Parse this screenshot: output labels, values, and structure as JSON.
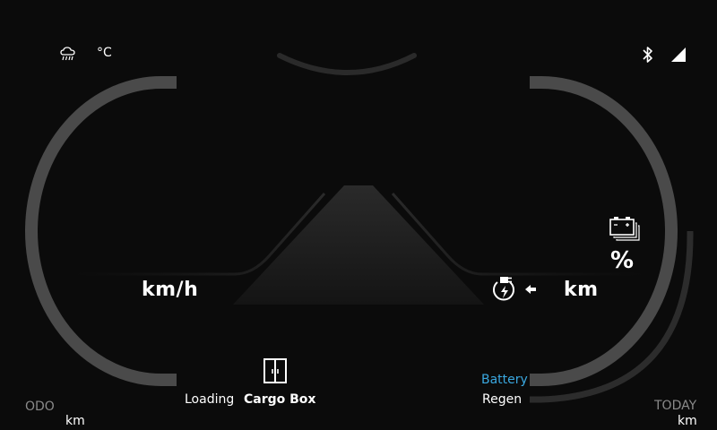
{
  "status_bar": {
    "weather_icon": "cloud-rain-icon",
    "temperature_unit": "°C",
    "bluetooth_icon": "bluetooth-icon",
    "signal_icon": "signal-icon"
  },
  "speed": {
    "unit": "km/h"
  },
  "battery": {
    "icon": "battery-pack-icon",
    "unit": "%"
  },
  "range": {
    "charge_icon": "plug-charge-icon",
    "arrow_icon": "arrow-left-icon",
    "unit": "km"
  },
  "cargo": {
    "loading_label": "Loading",
    "door_icon": "cargo-door-icon",
    "cargo_box_label": "Cargo Box"
  },
  "energy": {
    "battery_label": "Battery",
    "regen_label": "Regen"
  },
  "odometer": {
    "label": "ODO",
    "unit": "km"
  },
  "trip": {
    "label": "TODAY",
    "unit": "km"
  },
  "colors": {
    "background": "#0b0b0b",
    "gauge_arc": "#4a4a4a",
    "accent_blue": "#3aa8e0",
    "label_gray": "#8a8a8a"
  }
}
